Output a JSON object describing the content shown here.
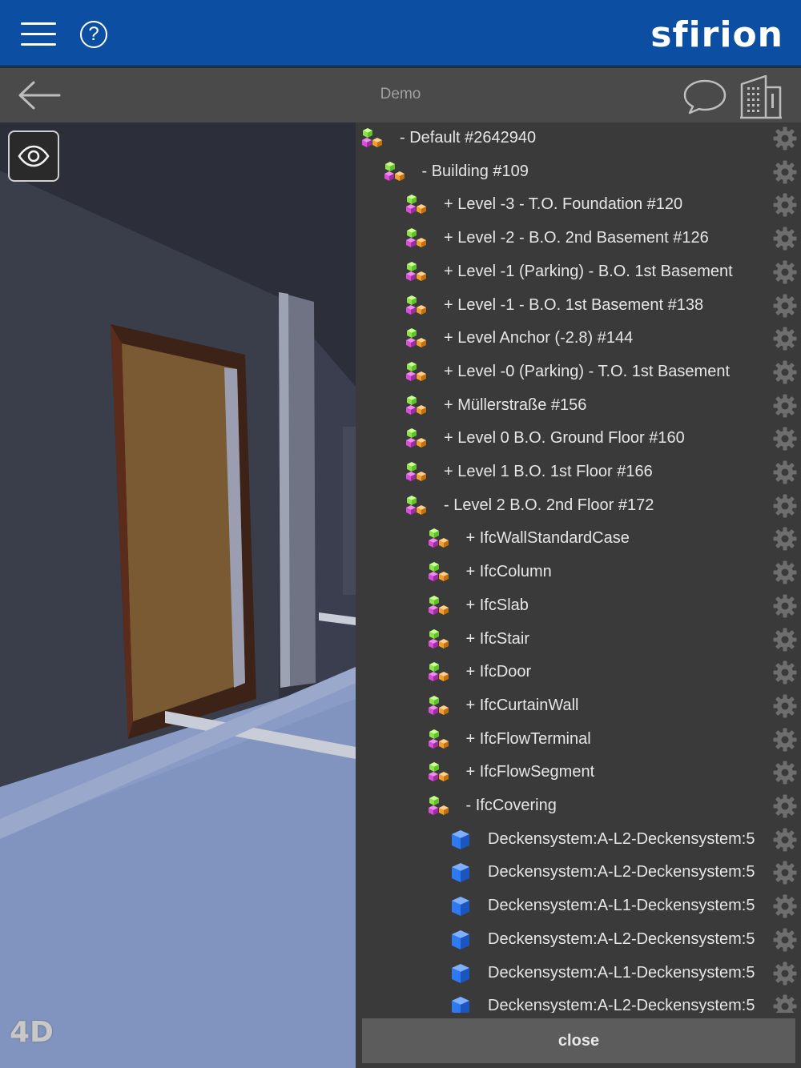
{
  "appbar": {
    "logo": "sfirion",
    "menu_icon": "hamburger-icon",
    "help_icon": "question-icon",
    "help_glyph": "?"
  },
  "subbar": {
    "title": "Demo",
    "back_icon": "arrow-left-icon",
    "chat_icon": "chat-bubble-icon",
    "building_icon": "building-icon"
  },
  "viewport": {
    "eye_icon": "eye-icon",
    "badge": "4D"
  },
  "tree": {
    "items": [
      {
        "label": "- Default #2642940",
        "depth": 0,
        "icon": "multi"
      },
      {
        "label": "- Building #109",
        "depth": 1,
        "icon": "multi"
      },
      {
        "label": "+ Level -3 - T.O. Foundation #120",
        "depth": 2,
        "icon": "multi"
      },
      {
        "label": "+ Level -2 - B.O. 2nd Basement #126",
        "depth": 2,
        "icon": "multi"
      },
      {
        "label": "+ Level -1 (Parking) - B.O. 1st Basement",
        "depth": 2,
        "icon": "multi"
      },
      {
        "label": "+ Level -1 - B.O. 1st Basement #138",
        "depth": 2,
        "icon": "multi"
      },
      {
        "label": "+ Level Anchor (-2.8) #144",
        "depth": 2,
        "icon": "multi"
      },
      {
        "label": "+ Level -0 (Parking) - T.O. 1st Basement",
        "depth": 2,
        "icon": "multi"
      },
      {
        "label": "+ Müllerstraße #156",
        "depth": 2,
        "icon": "multi"
      },
      {
        "label": "+ Level 0  B.O. Ground Floor #160",
        "depth": 2,
        "icon": "multi"
      },
      {
        "label": "+ Level 1  B.O. 1st Floor #166",
        "depth": 2,
        "icon": "multi"
      },
      {
        "label": "- Level 2  B.O. 2nd Floor #172",
        "depth": 2,
        "icon": "multi"
      },
      {
        "label": "+ IfcWallStandardCase",
        "depth": 3,
        "icon": "multi"
      },
      {
        "label": "+ IfcColumn",
        "depth": 3,
        "icon": "multi"
      },
      {
        "label": "+ IfcSlab",
        "depth": 3,
        "icon": "multi"
      },
      {
        "label": "+ IfcStair",
        "depth": 3,
        "icon": "multi"
      },
      {
        "label": "+ IfcDoor",
        "depth": 3,
        "icon": "multi"
      },
      {
        "label": "+ IfcCurtainWall",
        "depth": 3,
        "icon": "multi"
      },
      {
        "label": "+ IfcFlowTerminal",
        "depth": 3,
        "icon": "multi"
      },
      {
        "label": "+ IfcFlowSegment",
        "depth": 3,
        "icon": "multi"
      },
      {
        "label": "- IfcCovering",
        "depth": 3,
        "icon": "multi"
      },
      {
        "label": "Deckensystem:A-L2-Deckensystem:5",
        "depth": 4,
        "icon": "single"
      },
      {
        "label": "Deckensystem:A-L2-Deckensystem:5",
        "depth": 4,
        "icon": "single"
      },
      {
        "label": "Deckensystem:A-L1-Deckensystem:5",
        "depth": 4,
        "icon": "single"
      },
      {
        "label": "Deckensystem:A-L2-Deckensystem:5",
        "depth": 4,
        "icon": "single"
      },
      {
        "label": "Deckensystem:A-L1-Deckensystem:5",
        "depth": 4,
        "icon": "single"
      },
      {
        "label": "Deckensystem:A-L2-Deckensystem:5",
        "depth": 4,
        "icon": "single"
      }
    ],
    "gear_icon": "gear-icon",
    "close_label": "close"
  },
  "colors": {
    "appbar_bg": "#0b4ea2",
    "subbar_bg": "#4a4a4a",
    "panel_bg": "#3a3a3a",
    "cube_green": "#8fe34a",
    "cube_magenta": "#d64fd6",
    "cube_orange": "#f0a030",
    "cube_blue": "#2f7af0",
    "gear": "#6e6e6e"
  }
}
